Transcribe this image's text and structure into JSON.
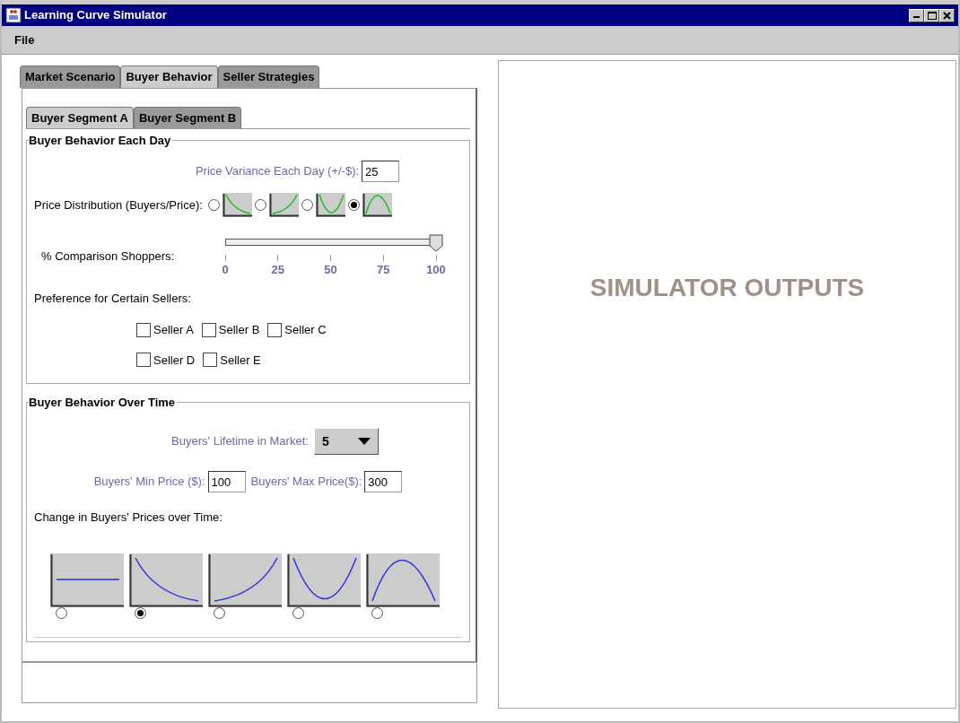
{
  "window": {
    "title": "Learning Curve Simulator"
  },
  "menu": [
    "File"
  ],
  "tabs": [
    {
      "label": "Market Scenario",
      "selected": false
    },
    {
      "label": "Buyer Behavior",
      "selected": true
    },
    {
      "label": "Seller Strategies",
      "selected": false
    }
  ],
  "segment_tabs": [
    {
      "label": "Buyer Segment A",
      "selected": true
    },
    {
      "label": "Buyer Segment B",
      "selected": false
    }
  ],
  "each_day": {
    "title": "Buyer Behavior Each Day",
    "variance_label": "Price Variance Each Day (+/-$):",
    "variance_value": "25",
    "distribution_label": "Price Distribution (Buyers/Price):",
    "distribution_options": [
      {
        "kind": "decreasing",
        "selected": false
      },
      {
        "kind": "increasing",
        "selected": false
      },
      {
        "kind": "valley",
        "selected": false
      },
      {
        "kind": "hump",
        "selected": true
      }
    ],
    "comparison_label": "% Comparison Shoppers:",
    "comparison_slider": {
      "level": 1,
      "ticks": [
        "0",
        "25",
        "50",
        "75",
        "100"
      ]
    },
    "preference_label": "Preference for Certain Sellers:",
    "sellers": [
      {
        "label": "Seller A",
        "checked": false
      },
      {
        "label": "Seller B",
        "checked": false
      },
      {
        "label": "Seller C",
        "checked": false
      },
      {
        "label": "Seller D",
        "checked": false
      },
      {
        "label": "Seller E",
        "checked": false
      }
    ]
  },
  "over_time": {
    "title": "Buyer Behavior Over Time",
    "lifetime_label": "Buyers' Lifetime in Market:",
    "lifetime_value": "5",
    "min_label": "Buyers' Min Price ($):",
    "min_value": "100",
    "max_label": "Buyers' Max Price($):",
    "max_value": "300",
    "change_label": "Change in Buyers' Prices over Time:",
    "change_options": [
      {
        "kind": "flat",
        "selected": false
      },
      {
        "kind": "decreasing",
        "selected": true
      },
      {
        "kind": "increasing",
        "selected": false
      },
      {
        "kind": "valley",
        "selected": false
      },
      {
        "kind": "hump",
        "selected": false
      }
    ]
  },
  "output": {
    "label": "SIMULATOR OUTPUTS"
  }
}
